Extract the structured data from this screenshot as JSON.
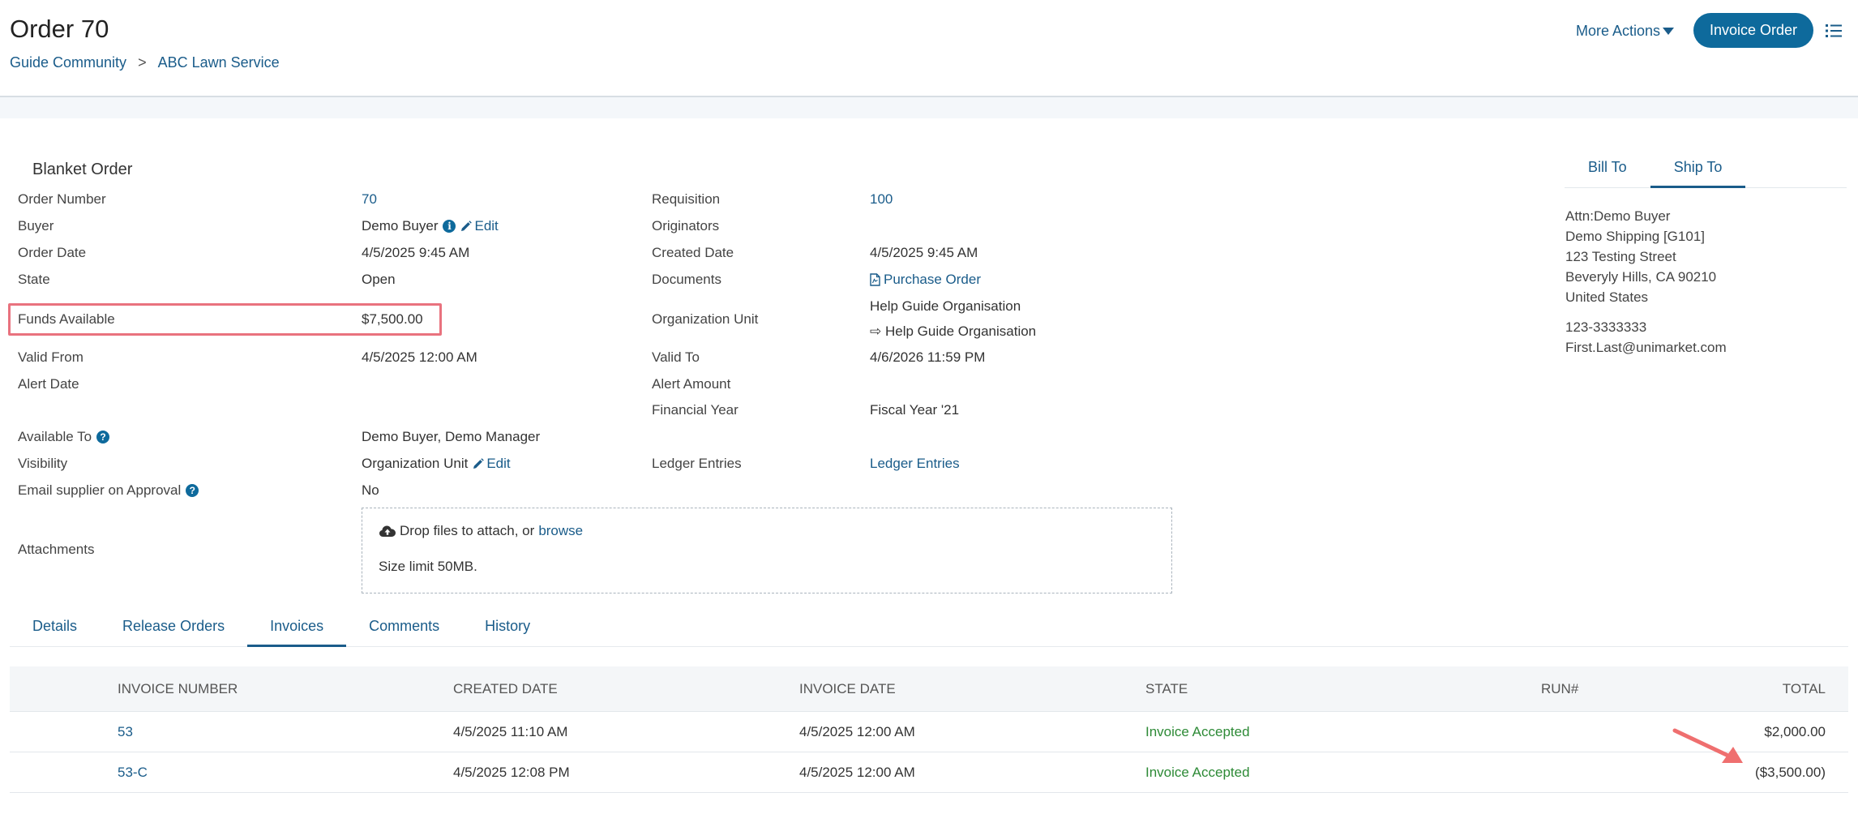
{
  "header": {
    "title": "Order 70",
    "breadcrumb": [
      "Guide Community",
      "ABC Lawn Service"
    ],
    "breadcrumb_separator": ">",
    "more_actions_label": "More Actions",
    "invoice_button_label": "Invoice Order"
  },
  "order": {
    "section_title": "Blanket Order",
    "order_number_label": "Order Number",
    "order_number": "70",
    "buyer_label": "Buyer",
    "buyer": "Demo Buyer",
    "edit_label": "Edit",
    "order_date_label": "Order Date",
    "order_date": "4/5/2025 9:45 AM",
    "state_label": "State",
    "state": "Open",
    "funds_label": "Funds Available",
    "funds": "$7,500.00",
    "valid_from_label": "Valid From",
    "valid_from": "4/5/2025 12:00 AM",
    "alert_date_label": "Alert Date",
    "available_to_label": "Available To",
    "available_to": "Demo Buyer, Demo Manager",
    "visibility_label": "Visibility",
    "visibility": "Organization Unit",
    "email_supplier_label": "Email supplier on Approval",
    "email_supplier": "No",
    "attachments_label": "Attachments",
    "requisition_label": "Requisition",
    "requisition": "100",
    "originators_label": "Originators",
    "created_date_label": "Created Date",
    "created_date": "4/5/2025 9:45 AM",
    "documents_label": "Documents",
    "documents": "Purchase Order",
    "org_unit_label": "Organization Unit",
    "org_unit_1": "Help Guide Organisation",
    "org_unit_2": "⇨ Help Guide Organisation",
    "valid_to_label": "Valid To",
    "valid_to": "4/6/2026 11:59 PM",
    "alert_amount_label": "Alert Amount",
    "financial_year_label": "Financial Year",
    "financial_year": "Fiscal Year '21",
    "ledger_label": "Ledger Entries",
    "ledger": "Ledger Entries"
  },
  "attachments": {
    "drop_text": "Drop files to attach, or",
    "browse_label": "browse",
    "size_limit": "Size limit 50MB."
  },
  "address": {
    "tabs": [
      "Bill To",
      "Ship To"
    ],
    "active_tab": "Ship To",
    "lines": [
      "Attn:Demo Buyer",
      "Demo Shipping [G101]",
      "123 Testing Street",
      "Beveryly Hills, CA 90210",
      "United States"
    ],
    "phone": "123-3333333",
    "email": "First.Last@unimarket.com"
  },
  "tabs": [
    "Details",
    "Release Orders",
    "Invoices",
    "Comments",
    "History"
  ],
  "active_tab": "Invoices",
  "invoices": {
    "columns": [
      "INVOICE NUMBER",
      "CREATED DATE",
      "INVOICE DATE",
      "STATE",
      "RUN#",
      "TOTAL"
    ],
    "rows": [
      {
        "number": "53",
        "created": "4/5/2025 11:10 AM",
        "invoice_date": "4/5/2025 12:00 AM",
        "state": "Invoice Accepted",
        "run": "",
        "total": "$2,000.00"
      },
      {
        "number": "53-C",
        "created": "4/5/2025 12:08 PM",
        "invoice_date": "4/5/2025 12:00 AM",
        "state": "Invoice Accepted",
        "run": "",
        "total": "($3,500.00)"
      }
    ]
  },
  "colors": {
    "primary": "#0e6a9c",
    "link": "#1a5c8a",
    "highlight": "#e9727e",
    "success": "#2d8a36"
  }
}
